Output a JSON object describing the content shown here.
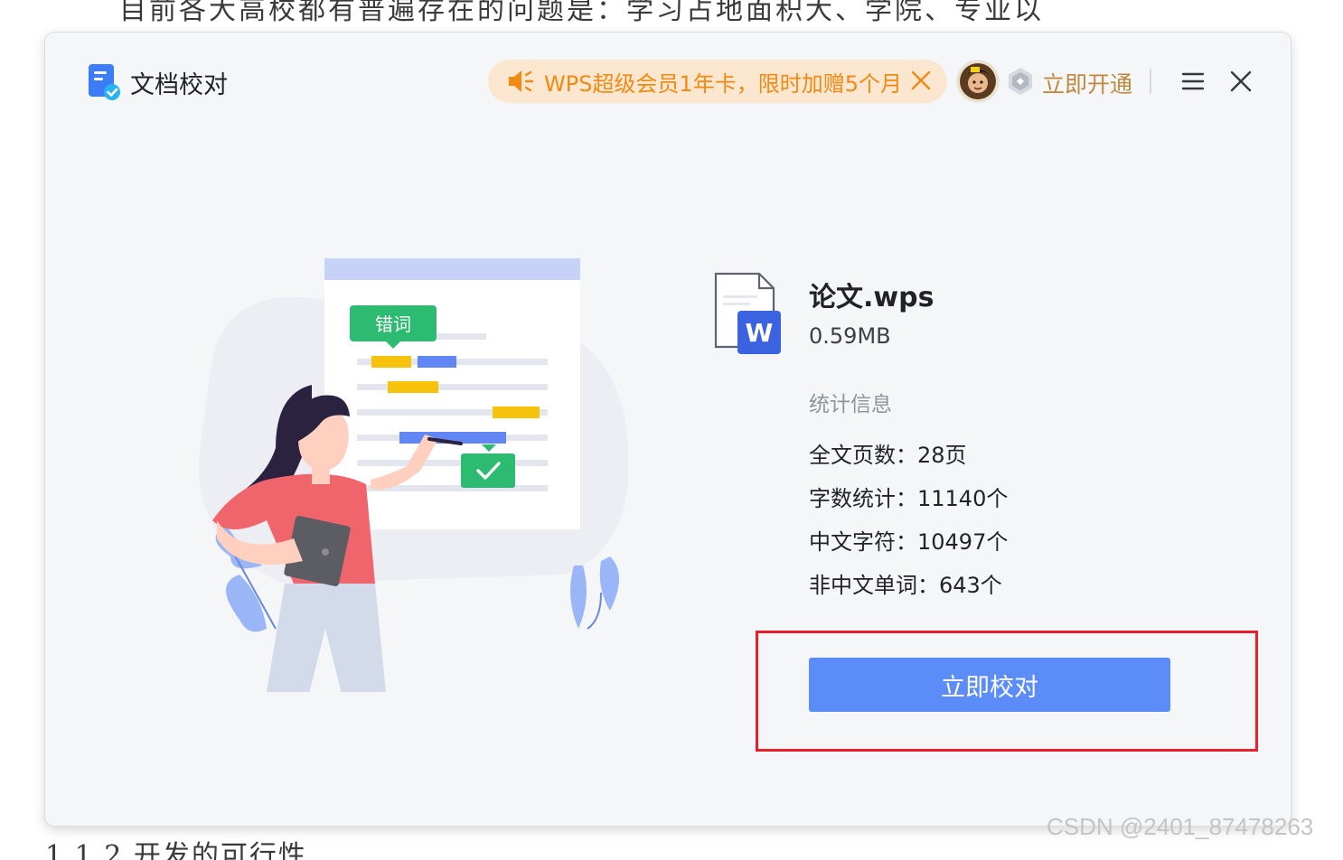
{
  "background_doc": {
    "top_line": "目前各大高校都有普遍存在的问题是：学习占地面积大、学院、专业以",
    "bottom_line": "1.1.2 开发的可行性"
  },
  "header": {
    "app_title": "文档校对",
    "promo_text": "WPS超级会员1年卡，限时加赠5个月",
    "open_now_label": "立即开通"
  },
  "illustration": {
    "tag_label": "错词"
  },
  "file": {
    "name": "论文.wps",
    "size": "0.59MB",
    "icon_letter": "W"
  },
  "stats": {
    "heading": "统计信息",
    "rows": [
      "全文页数：28页",
      "字数统计：11140个",
      "中文字符：10497个",
      "非中文单词：643个"
    ]
  },
  "action": {
    "proof_button_label": "立即校对"
  },
  "watermark": "CSDN @2401_87478263",
  "colors": {
    "accent": "#5b8cf8",
    "promo_bg": "#fbe7d0",
    "promo_text": "#f08a12",
    "highlight": "#e8202e",
    "tag_green": "#2dbb72"
  }
}
